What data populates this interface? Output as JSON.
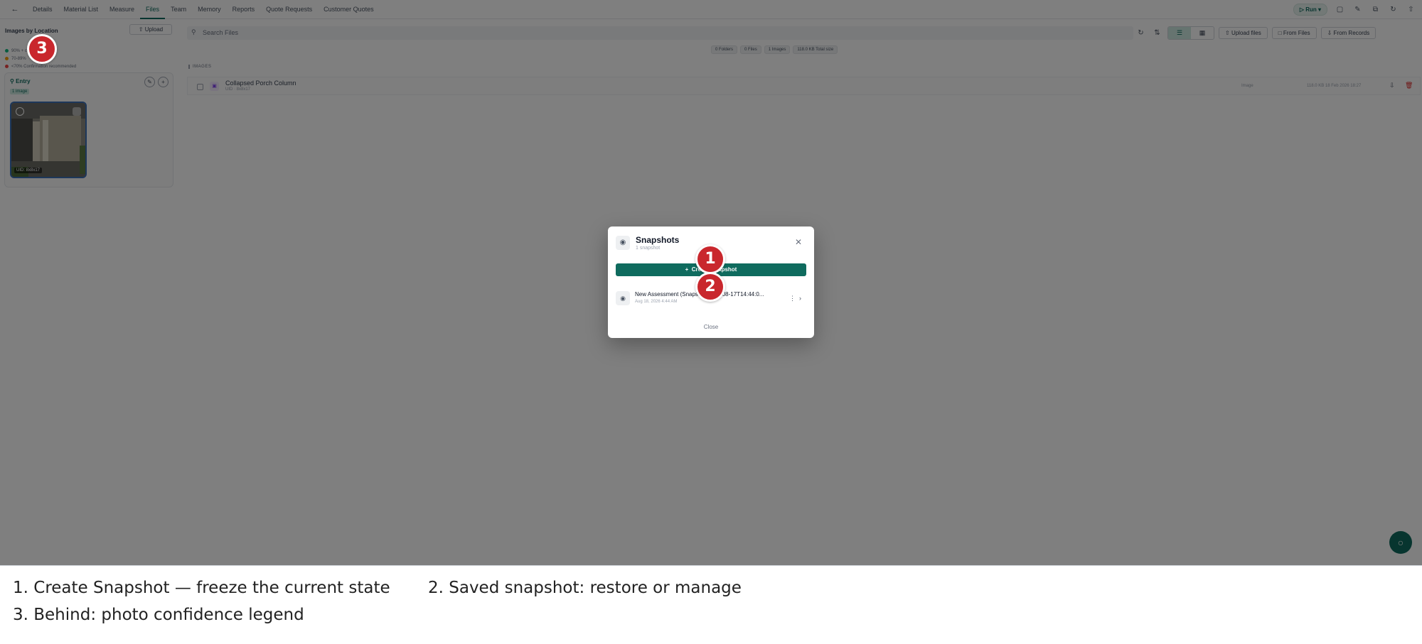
{
  "nav": {
    "tabs": [
      {
        "label": "Details"
      },
      {
        "label": "Material List"
      },
      {
        "label": "Measure"
      },
      {
        "label": "Files"
      },
      {
        "label": "Team"
      },
      {
        "label": "Memory"
      },
      {
        "label": "Reports"
      },
      {
        "label": "Quote Requests"
      },
      {
        "label": "Customer Quotes"
      }
    ],
    "active_tab": "Files",
    "run_label": "Run"
  },
  "sidebar": {
    "title": "Images by Location",
    "upload_label": "Upload",
    "legend": [
      {
        "label": "90% + confidence",
        "color": "#10b981"
      },
      {
        "label": "70-89%",
        "color": "#f59e0b"
      },
      {
        "label": "<70% Confirmation recommended",
        "color": "#ef4444"
      }
    ],
    "location": {
      "name": "Entry",
      "badge": "1 image",
      "thumb_caption": "UID: 8x8x17"
    }
  },
  "main": {
    "search_placeholder": "Search Files",
    "buttons": {
      "upload_files": "Upload files",
      "from_files": "From Files",
      "from_records": "From Records"
    },
    "stats": [
      {
        "label": "0 Folders"
      },
      {
        "label": "0 Files"
      },
      {
        "label": "1 Images"
      },
      {
        "label": "118.0 KB Total size"
      }
    ],
    "section_label": "IMAGES",
    "files": [
      {
        "name": "Collapsed Porch Column",
        "sub": "UID · 8x8x17",
        "type": "Image",
        "meta": "118.0 KB 18 Feb 2026 18:27"
      }
    ]
  },
  "modal": {
    "title": "Snapshots",
    "subtitle": "1 snapshot",
    "create_label": "Create Snapshot",
    "snapshots": [
      {
        "name": "New Assessment (Snapshot 2026-08-17T14:44:0...",
        "date": "Aug 18, 2026 4:44 AM"
      }
    ],
    "close_label": "Close"
  },
  "callouts": [
    "1",
    "2",
    "3"
  ],
  "caption": {
    "line1a": "1. Create Snapshot — freeze the current state",
    "line1b": "2. Saved snapshot: restore or manage",
    "line2": "3. Behind: photo confidence legend"
  },
  "colors": {
    "accent": "#0f6b5e",
    "callout": "#c9272d",
    "danger": "#dc2626"
  }
}
